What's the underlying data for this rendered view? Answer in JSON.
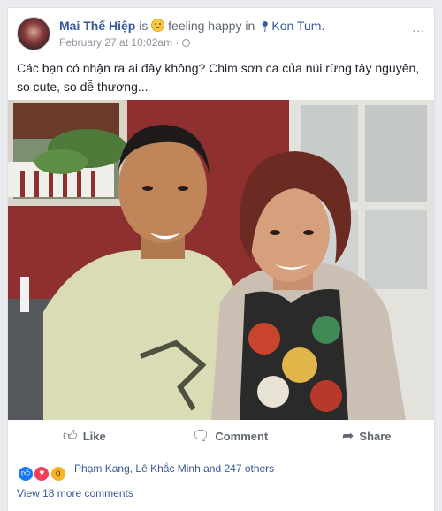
{
  "post": {
    "author": "Mai Thế Hiệp",
    "is_word": "is",
    "feeling": "feeling happy",
    "in_word": "in",
    "location": "Kon Tum.",
    "timestamp": "February 27 at 10:02am",
    "separator": "·",
    "more_label": "...",
    "text": "Các bạn có nhận ra ai đây không? Chim sơn ca của núi rừng tây nguyên, so cute, so dễ thương..."
  },
  "actions": {
    "like": "Like",
    "comment": "Comment",
    "share": "Share"
  },
  "reactions": {
    "names": "Phạm Kang, Lê Khắc Minh and 247 others"
  },
  "comments": {
    "view_more": "View 18 more comments"
  },
  "colors": {
    "link": "#365899",
    "like": "#1877f2",
    "love": "#f33e58",
    "wow": "#f7b125"
  }
}
